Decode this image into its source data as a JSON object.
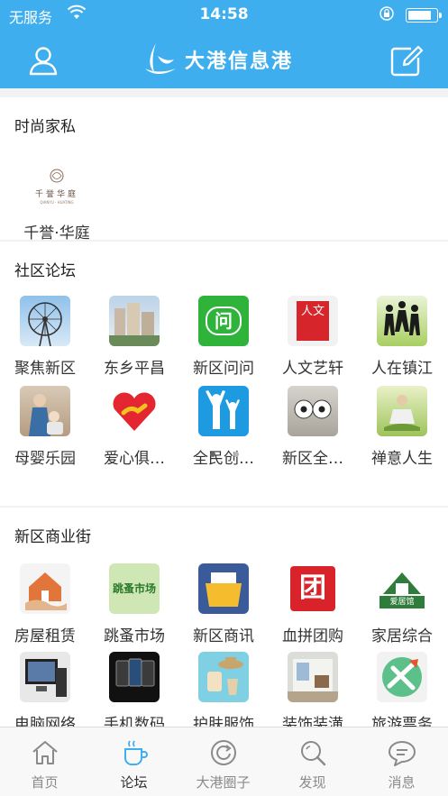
{
  "status": {
    "carrier": "无服务",
    "time": "14:58",
    "battery_level": 0.85
  },
  "nav": {
    "title": "大港信息港"
  },
  "sections": {
    "fashion": {
      "title": "时尚家私",
      "items": [
        {
          "label": "千誉·华庭",
          "logo_text": "千誉华庭",
          "logo_sub": "QIANYU · HUATING"
        }
      ]
    },
    "forum": {
      "title": "社区论坛",
      "items": [
        {
          "label": "聚焦新区",
          "icon": "ferris-wheel-icon"
        },
        {
          "label": "东乡平昌",
          "icon": "buildings-icon"
        },
        {
          "label": "新区问问",
          "icon": "question-chat-icon",
          "glyph": "问"
        },
        {
          "label": "人文艺轩",
          "icon": "culture-seal-icon",
          "glyph": "人文"
        },
        {
          "label": "人在镇江",
          "icon": "people-silhouette-icon"
        },
        {
          "label": "母婴乐园",
          "icon": "mother-baby-icon"
        },
        {
          "label": "爱心俱…",
          "icon": "heart-hand-icon"
        },
        {
          "label": "全民创…",
          "icon": "people-cheer-icon"
        },
        {
          "label": "新区全…",
          "icon": "football-icon"
        },
        {
          "label": "禅意人生",
          "icon": "meditation-icon"
        }
      ],
      "pages": 2,
      "current_page": 1
    },
    "business": {
      "title": "新区商业街",
      "items": [
        {
          "label": "房屋租赁",
          "icon": "house-hand-icon"
        },
        {
          "label": "跳蚤市场",
          "icon": "flea-market-icon",
          "glyph": "跳蚤市场"
        },
        {
          "label": "新区商讯",
          "icon": "folder-icon"
        },
        {
          "label": "血拼团购",
          "icon": "group-buy-icon",
          "glyph": "团"
        },
        {
          "label": "家居综合",
          "icon": "home-furnishing-icon",
          "glyph": "爱居馆"
        },
        {
          "label": "电脑网络",
          "icon": "computer-icon"
        },
        {
          "label": "手机数码",
          "icon": "phones-icon"
        },
        {
          "label": "护肤服饰",
          "icon": "fashion-icon"
        },
        {
          "label": "装饰装潢",
          "icon": "decoration-icon"
        },
        {
          "label": "旅游票务",
          "icon": "travel-icon"
        }
      ]
    }
  },
  "tabs": [
    {
      "label": "首页",
      "icon": "home-icon"
    },
    {
      "label": "论坛",
      "icon": "cup-icon",
      "active": true
    },
    {
      "label": "大港圈子",
      "icon": "circle-refresh-icon"
    },
    {
      "label": "发现",
      "icon": "search-icon"
    },
    {
      "label": "消息",
      "icon": "message-icon"
    }
  ],
  "colors": {
    "brand": "#3faeee",
    "text": "#333333",
    "tab_inactive": "#8a8a8a"
  }
}
